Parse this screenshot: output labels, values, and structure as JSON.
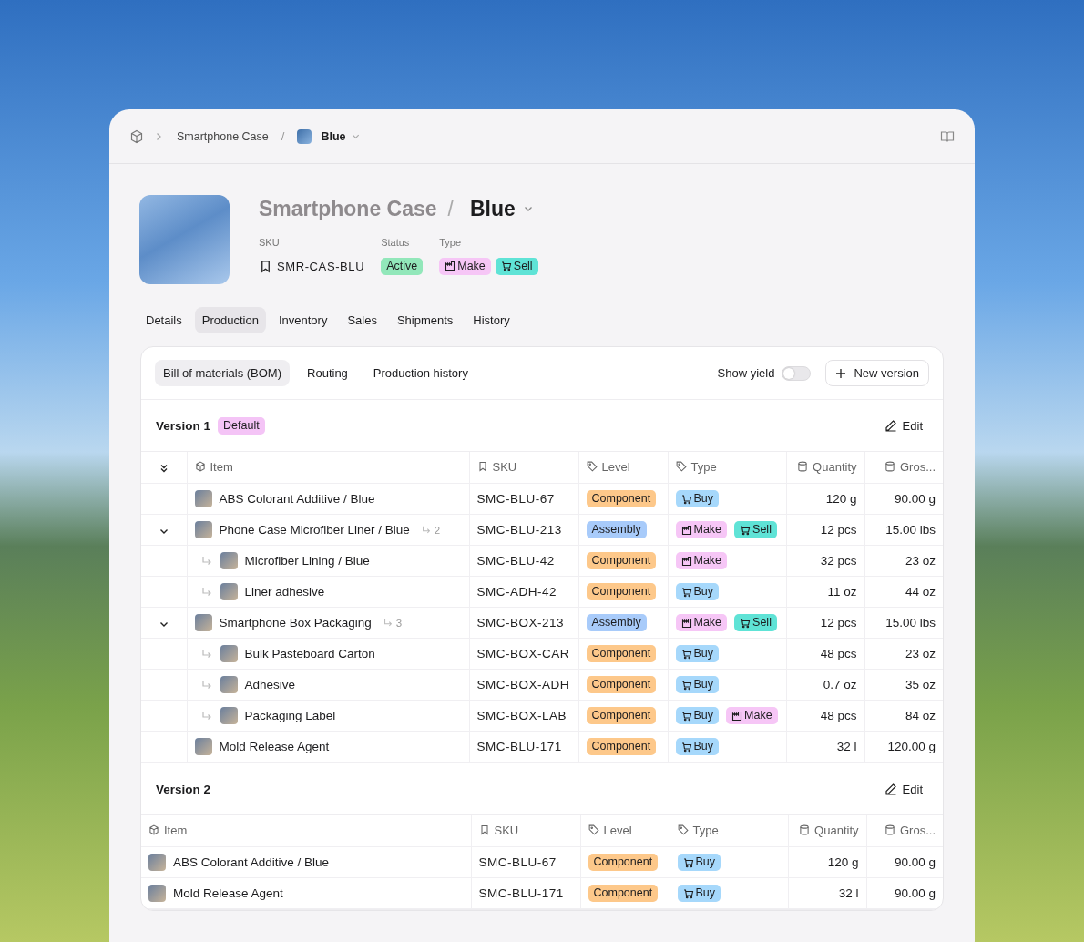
{
  "breadcrumb": {
    "parent": "Smartphone Case",
    "separator": "/",
    "current": "Blue"
  },
  "product": {
    "name": "Smartphone Case",
    "separator": "/",
    "variant": "Blue",
    "sku_label": "SKU",
    "sku": "SMR-CAS-BLU",
    "status_label": "Status",
    "status": "Active",
    "type_label": "Type",
    "types": [
      {
        "kind": "make",
        "label": "Make"
      },
      {
        "kind": "sell",
        "label": "Sell"
      }
    ]
  },
  "tabs": [
    {
      "label": "Details",
      "selected": false
    },
    {
      "label": "Production",
      "selected": true
    },
    {
      "label": "Inventory",
      "selected": false
    },
    {
      "label": "Sales",
      "selected": false
    },
    {
      "label": "Shipments",
      "selected": false
    },
    {
      "label": "History",
      "selected": false
    }
  ],
  "subtabs": [
    {
      "label": "Bill of materials (BOM)",
      "selected": true
    },
    {
      "label": "Routing",
      "selected": false
    },
    {
      "label": "Production history",
      "selected": false
    }
  ],
  "show_yield": {
    "label": "Show yield",
    "on": false
  },
  "new_version": "New version",
  "versions": [
    {
      "title": "Version 1",
      "badge": "Default",
      "edit": "Edit",
      "expand_column": true,
      "columns": [
        "Item",
        "SKU",
        "Level",
        "Type",
        "Quantity",
        "Gros..."
      ],
      "rows": [
        {
          "item": "ABS Colorant Additive / Blue",
          "sku": "SMC-BLU-67",
          "level": {
            "kind": "component",
            "label": "Component"
          },
          "types": [
            {
              "kind": "buy",
              "label": "Buy"
            }
          ],
          "quantity": "120 g",
          "gross": "90.00 g"
        },
        {
          "item": "Phone Case Microfiber Liner / Blue",
          "child_count": "2",
          "expanded": true,
          "sku": "SMC-BLU-213",
          "level": {
            "kind": "assembly",
            "label": "Assembly"
          },
          "types": [
            {
              "kind": "make",
              "label": "Make"
            },
            {
              "kind": "sell",
              "label": "Sell"
            }
          ],
          "quantity": "12 pcs",
          "gross": "15.00 lbs",
          "children": [
            {
              "item": "Microfiber Lining / Blue",
              "sku": "SMC-BLU-42",
              "level": {
                "kind": "component",
                "label": "Component"
              },
              "types": [
                {
                  "kind": "make",
                  "label": "Make"
                }
              ],
              "quantity": "32 pcs",
              "gross": "23 oz"
            },
            {
              "item": "Liner adhesive",
              "sku": "SMC-ADH-42",
              "level": {
                "kind": "component",
                "label": "Component"
              },
              "types": [
                {
                  "kind": "buy",
                  "label": "Buy"
                }
              ],
              "quantity": "11 oz",
              "gross": "44 oz"
            }
          ]
        },
        {
          "item": "Smartphone Box Packaging",
          "child_count": "3",
          "expanded": true,
          "sku": "SMC-BOX-213",
          "level": {
            "kind": "assembly",
            "label": "Assembly"
          },
          "types": [
            {
              "kind": "make",
              "label": "Make"
            },
            {
              "kind": "sell",
              "label": "Sell"
            }
          ],
          "quantity": "12 pcs",
          "gross": "15.00 lbs",
          "children": [
            {
              "item": "Bulk Pasteboard Carton",
              "sku": "SMC-BOX-CAR",
              "level": {
                "kind": "component",
                "label": "Component"
              },
              "types": [
                {
                  "kind": "buy",
                  "label": "Buy"
                }
              ],
              "quantity": "48 pcs",
              "gross": "23 oz"
            },
            {
              "item": "Adhesive",
              "sku": "SMC-BOX-ADH",
              "level": {
                "kind": "component",
                "label": "Component"
              },
              "types": [
                {
                  "kind": "buy",
                  "label": "Buy"
                }
              ],
              "quantity": "0.7 oz",
              "gross": "35 oz"
            },
            {
              "item": "Packaging Label",
              "sku": "SMC-BOX-LAB",
              "level": {
                "kind": "component",
                "label": "Component"
              },
              "types": [
                {
                  "kind": "buy",
                  "label": "Buy"
                },
                {
                  "kind": "make",
                  "label": "Make"
                }
              ],
              "quantity": "48 pcs",
              "gross": "84 oz"
            }
          ]
        },
        {
          "item": "Mold Release Agent",
          "sku": "SMC-BLU-171",
          "level": {
            "kind": "component",
            "label": "Component"
          },
          "types": [
            {
              "kind": "buy",
              "label": "Buy"
            }
          ],
          "quantity": "32 l",
          "gross": "120.00 g"
        }
      ]
    },
    {
      "title": "Version 2",
      "edit": "Edit",
      "expand_column": false,
      "columns": [
        "Item",
        "SKU",
        "Level",
        "Type",
        "Quantity",
        "Gros..."
      ],
      "rows": [
        {
          "item": "ABS Colorant Additive / Blue",
          "sku": "SMC-BLU-67",
          "level": {
            "kind": "component",
            "label": "Component"
          },
          "types": [
            {
              "kind": "buy",
              "label": "Buy"
            }
          ],
          "quantity": "120 g",
          "gross": "90.00 g"
        },
        {
          "item": "Mold Release Agent",
          "sku": "SMC-BLU-171",
          "level": {
            "kind": "component",
            "label": "Component"
          },
          "types": [
            {
              "kind": "buy",
              "label": "Buy"
            }
          ],
          "quantity": "32 l",
          "gross": "90.00 g"
        }
      ]
    }
  ]
}
